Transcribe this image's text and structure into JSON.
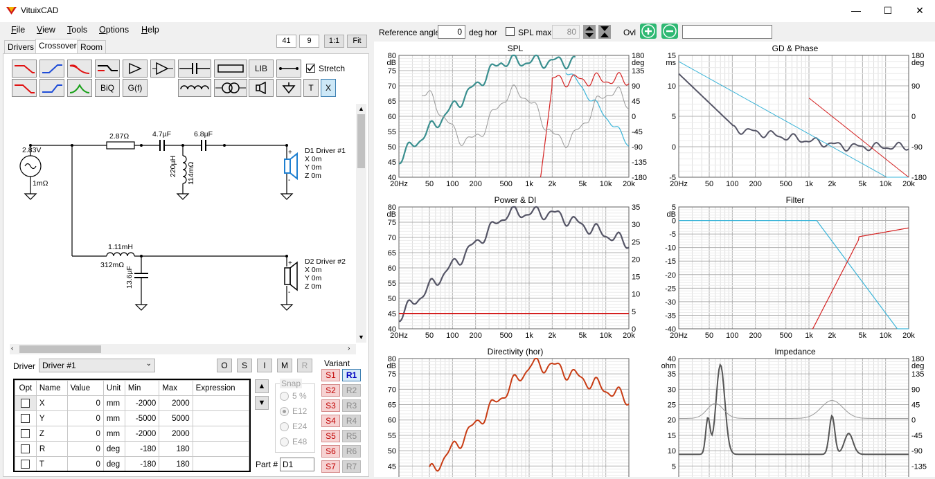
{
  "app": {
    "title": "VituixCAD",
    "icon": "vituixcad-logo-icon"
  },
  "window": {
    "minimize": "—",
    "maximize": "☐",
    "close": "✕"
  },
  "menu": [
    {
      "label": "File",
      "u": "F",
      "rest": "ile"
    },
    {
      "label": "View",
      "u": "V",
      "rest": "iew"
    },
    {
      "label": "Tools",
      "u": "T",
      "rest": "ools"
    },
    {
      "label": "Options",
      "u": "O",
      "rest": "ptions"
    },
    {
      "label": "Help",
      "u": "H",
      "rest": "elp"
    }
  ],
  "zoom": {
    "a": "41",
    "b": "9",
    "one_to_one": "1:1",
    "fit": "Fit"
  },
  "tabs": [
    "Drivers",
    "Crossover",
    "Room"
  ],
  "active_tab": "Crossover",
  "toolbar": {
    "lib": "LIB",
    "biq": "BiQ",
    "gf": "G(f)",
    "t": "T",
    "x": "X",
    "stretch_label": "Stretch",
    "stretch_checked": true
  },
  "schematic": {
    "source_voltage": "2.83V",
    "source_r": "1mΩ",
    "r1": "2.87Ω",
    "c1": "4.7µF",
    "c2": "6.8µF",
    "l1": "220µH",
    "l1_r": "114mΩ",
    "l2": "1.11mH",
    "l2_r": "312mΩ",
    "c3": "13.6µF",
    "d1_name": "D1 Driver #1",
    "d2_name": "D2 Driver #2",
    "d_x": "X 0m",
    "d_y": "Y 0m",
    "d_z": "Z 0m",
    "plus": "+",
    "minus": "-"
  },
  "driver_panel": {
    "label": "Driver",
    "selected": "Driver #1",
    "buttons": [
      "O",
      "S",
      "I",
      "M",
      "R"
    ],
    "columns": [
      "Opt",
      "Name",
      "Value",
      "Unit",
      "Min",
      "Max",
      "Expression"
    ],
    "rows": [
      {
        "name": "X",
        "value": "0",
        "unit": "mm",
        "min": "-2000",
        "max": "2000",
        "expr": ""
      },
      {
        "name": "Y",
        "value": "0",
        "unit": "mm",
        "min": "-5000",
        "max": "5000",
        "expr": ""
      },
      {
        "name": "Z",
        "value": "0",
        "unit": "mm",
        "min": "-2000",
        "max": "2000",
        "expr": ""
      },
      {
        "name": "R",
        "value": "0",
        "unit": "deg",
        "min": "-180",
        "max": "180",
        "expr": ""
      },
      {
        "name": "T",
        "value": "0",
        "unit": "deg",
        "min": "-180",
        "max": "180",
        "expr": ""
      }
    ],
    "snap": {
      "label": "Snap",
      "options": [
        "5 %",
        "E12",
        "E24",
        "E48"
      ],
      "selected": "E12"
    },
    "part_label": "Part #",
    "part_value": "D1",
    "variant": {
      "label": "Variant",
      "s": [
        "S1",
        "S2",
        "S3",
        "S4",
        "S5",
        "S6",
        "S7"
      ],
      "r": [
        "R1",
        "R2",
        "R3",
        "R4",
        "R5",
        "R6",
        "R7"
      ],
      "selected": "R1"
    }
  },
  "top_controls": {
    "ref_angle_label": "Reference angle",
    "ref_angle_value": "0",
    "ref_angle_unit": "deg hor",
    "spl_max_label": "SPL max",
    "spl_max_value": "80",
    "ovl_label": "Ovl",
    "ovl_text": ""
  },
  "graphs": {
    "spl": {
      "title": "SPL",
      "left_unit": "dB",
      "right_unit": "deg",
      "left_ticks": [
        "80",
        "75",
        "70",
        "65",
        "60",
        "55",
        "50",
        "45",
        "40"
      ],
      "right_ticks": [
        "180",
        "135",
        "90",
        "45",
        "0",
        "-45",
        "-90",
        "-135",
        "-180"
      ]
    },
    "gd": {
      "title": "GD & Phase",
      "left_unit": "ms",
      "right_unit": "deg",
      "left_ticks": [
        "15",
        "10",
        "5",
        "0",
        "-5"
      ],
      "right_ticks": [
        "180",
        "90",
        "0",
        "-90",
        "-180"
      ]
    },
    "power": {
      "title": "Power & DI",
      "left_unit": "dB",
      "left_ticks": [
        "80",
        "75",
        "70",
        "65",
        "60",
        "55",
        "50",
        "45",
        "40"
      ],
      "right_ticks": [
        "35",
        "30",
        "25",
        "20",
        "15",
        "10",
        "5",
        "0"
      ]
    },
    "filter": {
      "title": "Filter",
      "left_unit": "dB",
      "left_ticks": [
        "5",
        "0",
        "-5",
        "-10",
        "-15",
        "-20",
        "-25",
        "-30",
        "-35",
        "-40"
      ]
    },
    "directivity": {
      "title": "Directivity (hor)",
      "left_unit": "dB",
      "left_ticks": [
        "80",
        "75",
        "70",
        "65",
        "60",
        "55",
        "50",
        "45"
      ]
    },
    "impedance": {
      "title": "Impedance",
      "left_unit": "ohm",
      "right_unit": "deg",
      "left_ticks": [
        "40",
        "35",
        "30",
        "25",
        "20",
        "15",
        "10",
        "5"
      ],
      "right_ticks": [
        "180",
        "135",
        "90",
        "45",
        "0",
        "-45",
        "-90",
        "-135"
      ]
    },
    "x_ticks": [
      "20Hz",
      "50",
      "100",
      "200",
      "500",
      "1k",
      "2k",
      "5k",
      "10k",
      "20k"
    ]
  },
  "colors": {
    "red": "#d42020",
    "teal": "#3a8f8f",
    "cyan": "#3ab4d8",
    "gray": "#999999",
    "dark": "#555566",
    "orange": "#c83c14"
  }
}
